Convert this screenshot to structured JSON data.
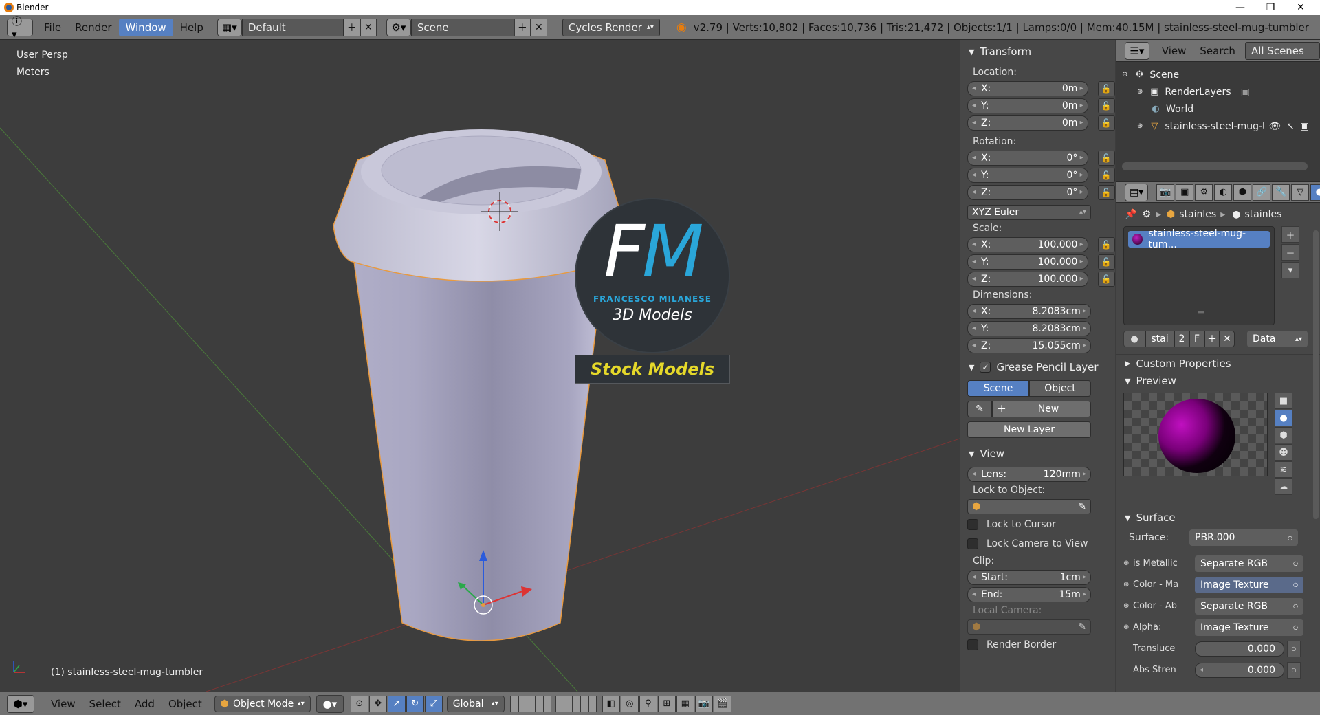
{
  "titlebar": {
    "title": "Blender"
  },
  "info": {
    "menus": [
      "File",
      "Render",
      "Window",
      "Help"
    ],
    "active_menu": "Window",
    "screen_layout": "Default",
    "scene": "Scene",
    "render_engine": "Cycles Render",
    "stats": "v2.79 | Verts:10,802 | Faces:10,736 | Tris:21,472 | Objects:1/1 | Lamps:0/0 | Mem:40.15M | stainless-steel-mug-tumbler"
  },
  "viewport": {
    "view_name": "User Persp",
    "units": "Meters",
    "object_label": "(1) stainless-steel-mug-tumbler",
    "watermark": {
      "logo": "FM",
      "brand": "FRANCESCO MILANESE",
      "subtitle": "3D Models",
      "tag": "Stock Models"
    }
  },
  "transform": {
    "title": "Transform",
    "location_label": "Location:",
    "location": [
      {
        "axis": "X:",
        "value": "0m"
      },
      {
        "axis": "Y:",
        "value": "0m"
      },
      {
        "axis": "Z:",
        "value": "0m"
      }
    ],
    "rotation_label": "Rotation:",
    "rotation": [
      {
        "axis": "X:",
        "value": "0°"
      },
      {
        "axis": "Y:",
        "value": "0°"
      },
      {
        "axis": "Z:",
        "value": "0°"
      }
    ],
    "rotation_mode": "XYZ Euler",
    "scale_label": "Scale:",
    "scale": [
      {
        "axis": "X:",
        "value": "100.000"
      },
      {
        "axis": "Y:",
        "value": "100.000"
      },
      {
        "axis": "Z:",
        "value": "100.000"
      }
    ],
    "dimensions_label": "Dimensions:",
    "dimensions": [
      {
        "axis": "X:",
        "value": "8.2083cm"
      },
      {
        "axis": "Y:",
        "value": "8.2083cm"
      },
      {
        "axis": "Z:",
        "value": "15.055cm"
      }
    ]
  },
  "grease_pencil": {
    "title": "Grease Pencil Layer",
    "tab_scene": "Scene",
    "tab_object": "Object",
    "new_label": "New",
    "new_layer_label": "New Layer"
  },
  "view_panel": {
    "title": "View",
    "lens_label": "Lens:",
    "lens_value": "120mm",
    "lock_to_object": "Lock to Object:",
    "lock_to_cursor": "Lock to Cursor",
    "lock_camera": "Lock Camera to View",
    "clip_label": "Clip:",
    "clip_start_label": "Start:",
    "clip_start": "1cm",
    "clip_end_label": "End:",
    "clip_end": "15m",
    "local_camera": "Local Camera:",
    "render_border": "Render Border"
  },
  "outliner": {
    "menus": [
      "View",
      "Search"
    ],
    "filter": "All Scenes",
    "items": [
      "Scene",
      "RenderLayers",
      "World",
      "stainless-steel-mug-tu"
    ]
  },
  "material": {
    "breadcrumb_a": "stainles",
    "breadcrumb_b": "stainles",
    "slot_name": "stainless-steel-mug-tum...",
    "mat_short": "stai",
    "users": "2",
    "fake": "F",
    "link": "Data",
    "custom_props": "Custom Properties",
    "preview": "Preview",
    "surface_title": "Surface",
    "surface_label": "Surface:",
    "surface_value": "PBR.000",
    "inputs": [
      {
        "label": "is Metallic",
        "value": "Separate RGB"
      },
      {
        "label": "Color - Ma",
        "value": "Image Texture"
      },
      {
        "label": "Color - Ab",
        "value": "Separate RGB"
      },
      {
        "label": "Alpha:",
        "value": "Image Texture"
      }
    ],
    "translucency_label": "Transluce",
    "translucency_value": "0.000",
    "abs_strength_label": "Abs Stren",
    "abs_strength_value": "0.000"
  },
  "footer": {
    "menus": [
      "View",
      "Select",
      "Add",
      "Object"
    ],
    "mode": "Object Mode",
    "orientation": "Global"
  }
}
